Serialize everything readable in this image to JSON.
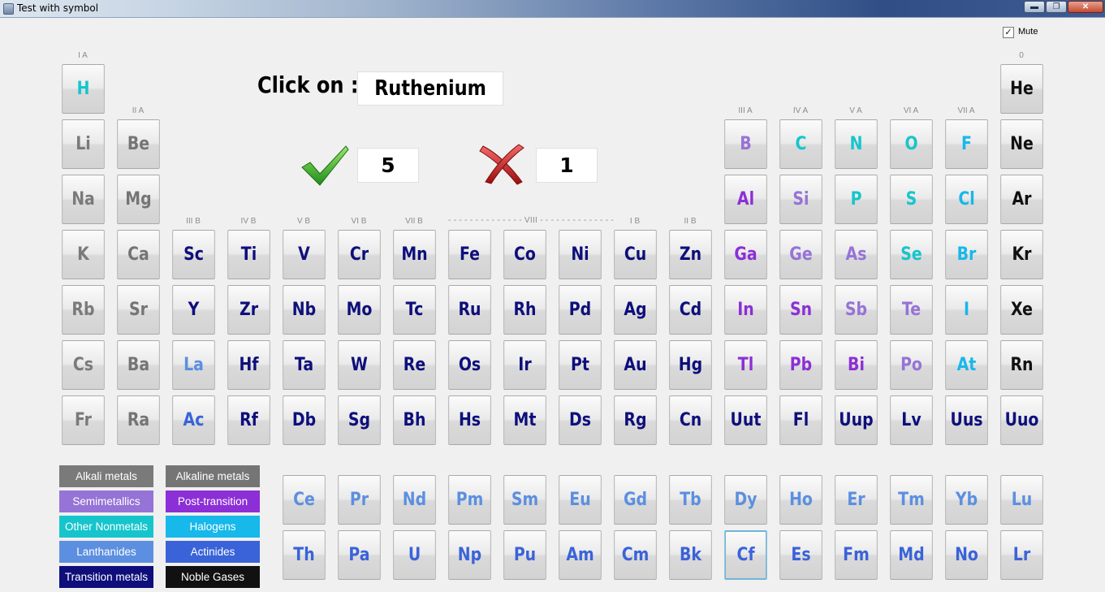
{
  "window": {
    "title": "Test with symbol"
  },
  "controls": {
    "mute_label": "Mute",
    "mute_checked": true,
    "check_mark": "✓",
    "min_glyph": "▬",
    "max_glyph": "❐",
    "close_glyph": "✕"
  },
  "quiz": {
    "prompt": "Click on :",
    "target": "Ruthenium",
    "correct": "5",
    "wrong": "1"
  },
  "colors": {
    "alkali": "#7a7a7a",
    "alkaline": "#757575",
    "semimetal": "#9673d6",
    "post_transition": "#8c2fd6",
    "nonmetal": "#16c5cc",
    "halogen": "#17b8ea",
    "lanthanide": "#5c8fe0",
    "actinide": "#3a63d9",
    "transition": "#0e0f7b",
    "noble": "#111111"
  },
  "group_labels": [
    "I A",
    "II A",
    "III B",
    "IV B",
    "V B",
    "VI B",
    "VII B",
    "- - - - - - - - - - - - - - VIII - - - - - - - - - - - - - -",
    "I B",
    "II B",
    "III A",
    "IV A",
    "V A",
    "VI A",
    "VII A",
    "0"
  ],
  "elements": [
    [
      "H",
      "nonmetal"
    ],
    [
      "He",
      "noble"
    ],
    [
      "Li",
      "alkali"
    ],
    [
      "Be",
      "alkaline"
    ],
    [
      "B",
      "semimetal"
    ],
    [
      "C",
      "nonmetal"
    ],
    [
      "N",
      "nonmetal"
    ],
    [
      "O",
      "nonmetal"
    ],
    [
      "F",
      "halogen"
    ],
    [
      "Ne",
      "noble"
    ],
    [
      "Na",
      "alkali"
    ],
    [
      "Mg",
      "alkaline"
    ],
    [
      "Al",
      "post_transition"
    ],
    [
      "Si",
      "semimetal"
    ],
    [
      "P",
      "nonmetal"
    ],
    [
      "S",
      "nonmetal"
    ],
    [
      "Cl",
      "halogen"
    ],
    [
      "Ar",
      "noble"
    ],
    [
      "K",
      "alkali"
    ],
    [
      "Ca",
      "alkaline"
    ],
    [
      "Sc",
      "transition"
    ],
    [
      "Ti",
      "transition"
    ],
    [
      "V",
      "transition"
    ],
    [
      "Cr",
      "transition"
    ],
    [
      "Mn",
      "transition"
    ],
    [
      "Fe",
      "transition"
    ],
    [
      "Co",
      "transition"
    ],
    [
      "Ni",
      "transition"
    ],
    [
      "Cu",
      "transition"
    ],
    [
      "Zn",
      "transition"
    ],
    [
      "Ga",
      "post_transition"
    ],
    [
      "Ge",
      "semimetal"
    ],
    [
      "As",
      "semimetal"
    ],
    [
      "Se",
      "nonmetal"
    ],
    [
      "Br",
      "halogen"
    ],
    [
      "Kr",
      "noble"
    ],
    [
      "Rb",
      "alkali"
    ],
    [
      "Sr",
      "alkaline"
    ],
    [
      "Y",
      "transition"
    ],
    [
      "Zr",
      "transition"
    ],
    [
      "Nb",
      "transition"
    ],
    [
      "Mo",
      "transition"
    ],
    [
      "Tc",
      "transition"
    ],
    [
      "Ru",
      "transition"
    ],
    [
      "Rh",
      "transition"
    ],
    [
      "Pd",
      "transition"
    ],
    [
      "Ag",
      "transition"
    ],
    [
      "Cd",
      "transition"
    ],
    [
      "In",
      "post_transition"
    ],
    [
      "Sn",
      "post_transition"
    ],
    [
      "Sb",
      "semimetal"
    ],
    [
      "Te",
      "semimetal"
    ],
    [
      "I",
      "halogen"
    ],
    [
      "Xe",
      "noble"
    ],
    [
      "Cs",
      "alkali"
    ],
    [
      "Ba",
      "alkaline"
    ],
    [
      "La",
      "lanthanide"
    ],
    [
      "Hf",
      "transition"
    ],
    [
      "Ta",
      "transition"
    ],
    [
      "W",
      "transition"
    ],
    [
      "Re",
      "transition"
    ],
    [
      "Os",
      "transition"
    ],
    [
      "Ir",
      "transition"
    ],
    [
      "Pt",
      "transition"
    ],
    [
      "Au",
      "transition"
    ],
    [
      "Hg",
      "transition"
    ],
    [
      "Tl",
      "post_transition"
    ],
    [
      "Pb",
      "post_transition"
    ],
    [
      "Bi",
      "post_transition"
    ],
    [
      "Po",
      "semimetal"
    ],
    [
      "At",
      "halogen"
    ],
    [
      "Rn",
      "noble"
    ],
    [
      "Fr",
      "alkali"
    ],
    [
      "Ra",
      "alkaline"
    ],
    [
      "Ac",
      "actinide"
    ],
    [
      "Rf",
      "transition"
    ],
    [
      "Db",
      "transition"
    ],
    [
      "Sg",
      "transition"
    ],
    [
      "Bh",
      "transition"
    ],
    [
      "Hs",
      "transition"
    ],
    [
      "Mt",
      "transition"
    ],
    [
      "Ds",
      "transition"
    ],
    [
      "Rg",
      "transition"
    ],
    [
      "Cn",
      "transition"
    ],
    [
      "Uut",
      "transition"
    ],
    [
      "Fl",
      "transition"
    ],
    [
      "Uup",
      "transition"
    ],
    [
      "Lv",
      "transition"
    ],
    [
      "Uus",
      "transition"
    ],
    [
      "Uuo",
      "transition"
    ],
    [
      "Ce",
      "lanthanide"
    ],
    [
      "Pr",
      "lanthanide"
    ],
    [
      "Nd",
      "lanthanide"
    ],
    [
      "Pm",
      "lanthanide"
    ],
    [
      "Sm",
      "lanthanide"
    ],
    [
      "Eu",
      "lanthanide"
    ],
    [
      "Gd",
      "lanthanide"
    ],
    [
      "Tb",
      "lanthanide"
    ],
    [
      "Dy",
      "lanthanide"
    ],
    [
      "Ho",
      "lanthanide"
    ],
    [
      "Er",
      "lanthanide"
    ],
    [
      "Tm",
      "lanthanide"
    ],
    [
      "Yb",
      "lanthanide"
    ],
    [
      "Lu",
      "lanthanide"
    ],
    [
      "Th",
      "actinide"
    ],
    [
      "Pa",
      "actinide"
    ],
    [
      "U",
      "actinide"
    ],
    [
      "Np",
      "actinide"
    ],
    [
      "Pu",
      "actinide"
    ],
    [
      "Am",
      "actinide"
    ],
    [
      "Cm",
      "actinide"
    ],
    [
      "Bk",
      "actinide"
    ],
    [
      "Cf",
      "actinide"
    ],
    [
      "Es",
      "actinide"
    ],
    [
      "Fm",
      "actinide"
    ],
    [
      "Md",
      "actinide"
    ],
    [
      "No",
      "actinide"
    ],
    [
      "Lr",
      "actinide"
    ]
  ],
  "selected_element": "Cf",
  "legend": [
    [
      "Alkali metals",
      "alkali"
    ],
    [
      "Alkaline metals",
      "alkaline"
    ],
    [
      "Semimetallics",
      "semimetal"
    ],
    [
      "Post-transition",
      "post_transition"
    ],
    [
      "Other Nonmetals",
      "nonmetal"
    ],
    [
      "Halogens",
      "halogen"
    ],
    [
      "Lanthanides",
      "lanthanide"
    ],
    [
      "Actinides",
      "actinide"
    ],
    [
      "Transition metals",
      "transition"
    ],
    [
      "Noble Gases",
      "noble"
    ]
  ],
  "icons": {
    "app": "app-icon",
    "correct": "checkmark-icon",
    "wrong": "cross-icon"
  }
}
